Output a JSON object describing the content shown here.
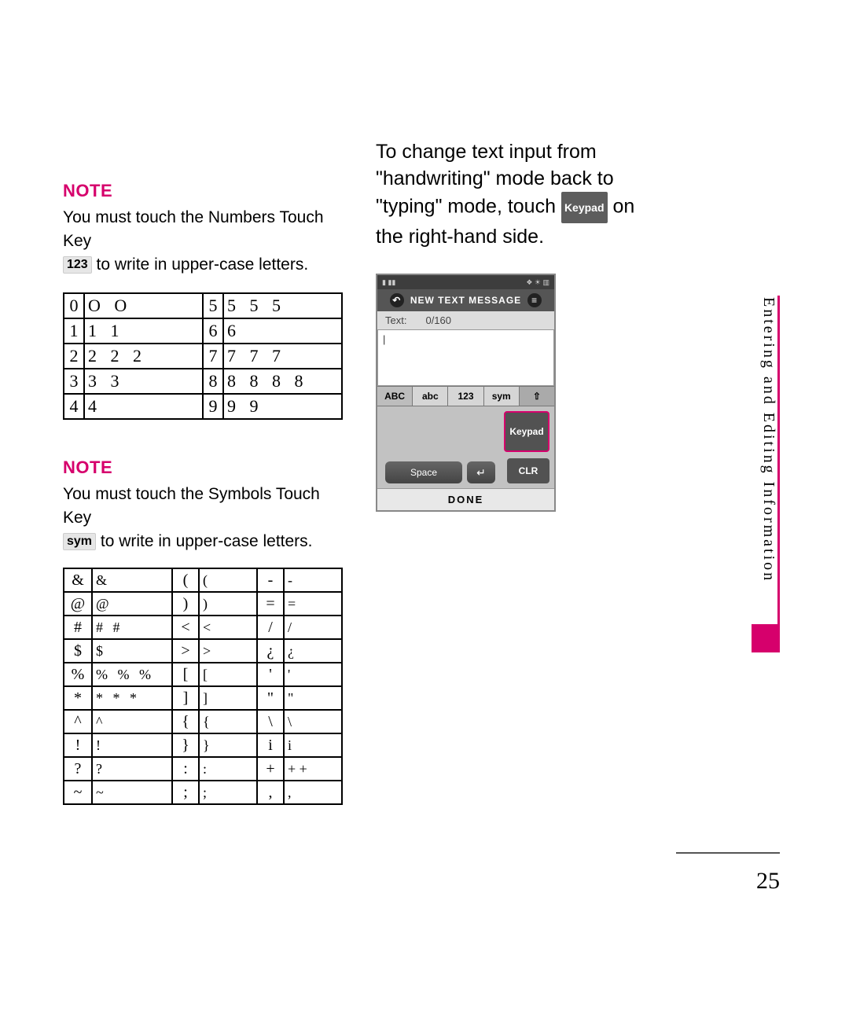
{
  "accent_color": "#d6006c",
  "left": {
    "note1": {
      "heading": "NOTE",
      "line1": "You must touch the Numbers Touch Key",
      "keycap": "123",
      "line2": " to write in upper-case letters."
    },
    "numbers_table": [
      {
        "l_key": "0",
        "l_strokes": "O  O",
        "r_key": "5",
        "r_strokes": "5 5 5"
      },
      {
        "l_key": "1",
        "l_strokes": "1  1",
        "r_key": "6",
        "r_strokes": "6"
      },
      {
        "l_key": "2",
        "l_strokes": "2 2 2",
        "r_key": "7",
        "r_strokes": "7 7 7"
      },
      {
        "l_key": "3",
        "l_strokes": "3 3",
        "r_key": "8",
        "r_strokes": "8 8 8 8"
      },
      {
        "l_key": "4",
        "l_strokes": "4",
        "r_key": "9",
        "r_strokes": "9 9"
      }
    ],
    "note2": {
      "heading": "NOTE",
      "line1": "You must touch the Symbols Touch Key",
      "keycap": "sym",
      "line2": " to write in upper-case letters."
    },
    "symbols_table": [
      {
        "a": "&",
        "as": "&",
        "b": "(",
        "bs": "(",
        "c": "-",
        "cs": "-"
      },
      {
        "a": "@",
        "as": "@",
        "b": ")",
        "bs": ")",
        "c": "=",
        "cs": "="
      },
      {
        "a": "#",
        "as": "# #",
        "b": "<",
        "bs": "<",
        "c": "/",
        "cs": "/"
      },
      {
        "a": "$",
        "as": "$",
        "b": ">",
        "bs": ">",
        "c": "¿",
        "cs": "¿"
      },
      {
        "a": "%",
        "as": "% % %",
        "b": "[",
        "bs": "[",
        "c": "'",
        "cs": "'"
      },
      {
        "a": "*",
        "as": "* * *",
        "b": "]",
        "bs": "]",
        "c": "\"",
        "cs": "\""
      },
      {
        "a": "^",
        "as": "^",
        "b": "{",
        "bs": "{",
        "c": "\\",
        "cs": "\\"
      },
      {
        "a": "!",
        "as": "!",
        "b": "}",
        "bs": "}",
        "c": "i",
        "cs": "i"
      },
      {
        "a": "?",
        "as": "?",
        "b": ":",
        "bs": ":",
        "c": "+",
        "cs": "+ +"
      },
      {
        "a": "~",
        "as": "~",
        "b": ";",
        "bs": ";",
        "c": ",",
        "cs": ","
      }
    ]
  },
  "right": {
    "para1": "To change text input from \"handwriting\" mode back to \"typing\" mode, touch ",
    "keypad_cap": "Keypad",
    "para2": " on the right-hand side.",
    "phone": {
      "status_left": "▮ ▮▮",
      "status_right": "❖ ☀ ▥",
      "back_icon": "↶",
      "title": "NEW TEXT MESSAGE",
      "menu_icon": "≡",
      "text_label": "Text:",
      "counter": "0/160",
      "textarea": "|",
      "modes": {
        "abc_up": "ABC",
        "abc_lo": "abc",
        "num": "123",
        "sym": "sym",
        "shift": "⇧"
      },
      "keypad": "Keypad",
      "clr": "CLR",
      "space": "Space",
      "enter": "↵",
      "done": "DONE"
    }
  },
  "side_tab": "Entering and Editing Information",
  "page_no": "25"
}
